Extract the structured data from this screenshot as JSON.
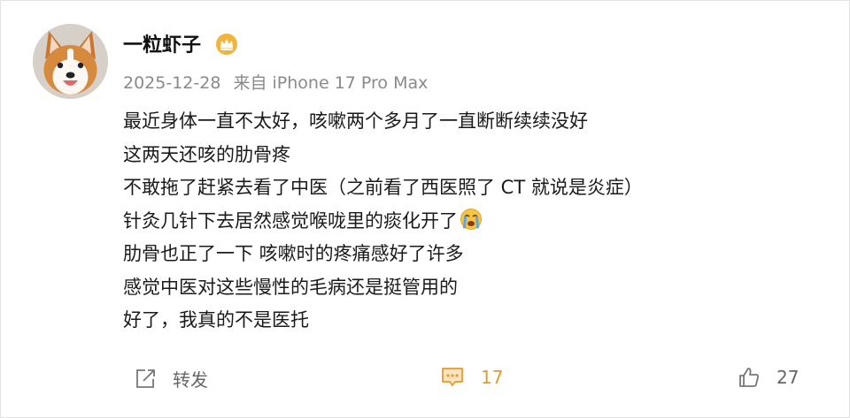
{
  "post": {
    "author": "一粒虾子",
    "date": "2025-12-28",
    "source": "来自 iPhone 17 Pro Max",
    "lines": [
      "最近身体一直不太好，咳嗽两个多月了一直断断续续没好",
      "这两天还咳的肋骨疼",
      "不敢拖了赶紧去看了中医（之前看了西医照了 CT 就说是炎症）",
      "针灸几针下去居然感觉喉咙里的痰化开了",
      "肋骨也正了一下 咳嗽时的疼痛感好了许多",
      "感觉中医对这些慢性的毛病还是挺管用的",
      "好了，我真的不是医托"
    ],
    "inline_emoji": "crying-emoji"
  },
  "actions": {
    "forward_label": "转发",
    "comment_count": "17",
    "like_count": "27"
  },
  "colors": {
    "meta_text": "#8a8a8a",
    "comment_accent": "#e59a2e",
    "badge": "#f2b43a"
  }
}
